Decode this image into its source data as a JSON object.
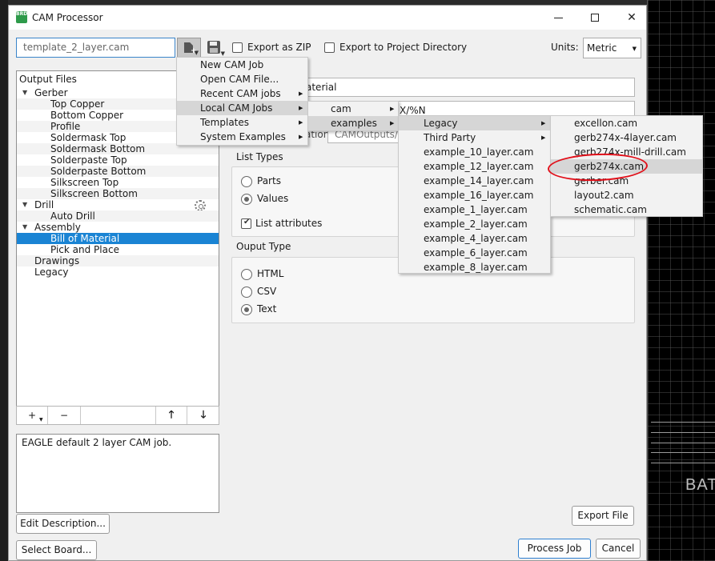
{
  "background": {
    "board_label": "BAT"
  },
  "window": {
    "title": "CAM Processor",
    "app_icon": "eagle-brd-icon",
    "controls": [
      "minimize-icon",
      "maximize-icon",
      "close-icon"
    ]
  },
  "toolbar": {
    "template_value": "template_2_layer.cam",
    "export_zip_label": "Export as ZIP",
    "export_zip_checked": false,
    "export_project_label": "Export to Project Directory",
    "export_project_checked": false,
    "units_label": "Units:",
    "units_value": "Metric"
  },
  "tree": {
    "header": "Output Files",
    "items": [
      {
        "label": "Gerber",
        "level": 0,
        "expanded": true
      },
      {
        "label": "Top Copper",
        "level": 1
      },
      {
        "label": "Bottom Copper",
        "level": 1
      },
      {
        "label": "Profile",
        "level": 1
      },
      {
        "label": "Soldermask Top",
        "level": 1
      },
      {
        "label": "Soldermask Bottom",
        "level": 1
      },
      {
        "label": "Solderpaste Top",
        "level": 1
      },
      {
        "label": "Solderpaste Bottom",
        "level": 1
      },
      {
        "label": "Silkscreen Top",
        "level": 1
      },
      {
        "label": "Silkscreen Bottom",
        "level": 1
      },
      {
        "label": "Drill",
        "level": 0,
        "expanded": true
      },
      {
        "label": "Auto Drill",
        "level": 1
      },
      {
        "label": "Assembly",
        "level": 0,
        "expanded": true
      },
      {
        "label": "Bill of Material",
        "level": 1,
        "selected": true
      },
      {
        "label": "Pick and Place",
        "level": 1
      },
      {
        "label": "Drawings",
        "level": 0
      },
      {
        "label": "Legacy",
        "level": 0
      }
    ],
    "toolbar": {
      "add": "+",
      "remove": "−",
      "up_icon": "arrow-up-icon",
      "down_icon": "arrow-down-icon"
    }
  },
  "description": "EAGLE default 2 layer CAM job.",
  "buttons": {
    "edit_description": "Edit Description...",
    "select_board": "Select Board...",
    "export_file": "Export File",
    "process_job": "Process Job",
    "cancel": "Cancel"
  },
  "details": {
    "name_value_partial": "aterial",
    "format_value_partial": "X/%N",
    "location_label_partial": "ation",
    "location_value_partial": "CAMOutputs/",
    "list_types_title": "List Types",
    "list_types": [
      {
        "label": "Parts",
        "selected": false
      },
      {
        "label": "Values",
        "selected": true
      }
    ],
    "list_attributes_label": "List attributes",
    "list_attributes_checked": true,
    "output_type_title": "Ouput Type",
    "output_types": [
      {
        "label": "HTML",
        "selected": false
      },
      {
        "label": "CSV",
        "selected": false
      },
      {
        "label": "Text",
        "selected": true
      }
    ]
  },
  "menus": {
    "new_menu": [
      "New CAM Job",
      "Open CAM File...",
      "Recent CAM jobs",
      "Local CAM Jobs",
      "Templates",
      "System Examples"
    ],
    "local_cam_jobs": [
      "cam",
      "examples"
    ],
    "examples": [
      "Legacy",
      "Third Party",
      "example_10_layer.cam",
      "example_12_layer.cam",
      "example_14_layer.cam",
      "example_16_layer.cam",
      "example_1_layer.cam",
      "example_2_layer.cam",
      "example_4_layer.cam",
      "example_6_layer.cam",
      "example_8_layer.cam"
    ],
    "legacy": [
      "excellon.cam",
      "gerb274x-4layer.cam",
      "gerb274x-mill-drill.cam",
      "gerb274x.cam",
      "gerber.cam",
      "layout2.cam",
      "schematic.cam"
    ],
    "highlighted_legacy_item": "gerb274x.cam"
  },
  "colors": {
    "selection_blue": "#1a84d4",
    "annotation_red": "#e1101a",
    "field_focus_blue": "#3a84c9"
  }
}
